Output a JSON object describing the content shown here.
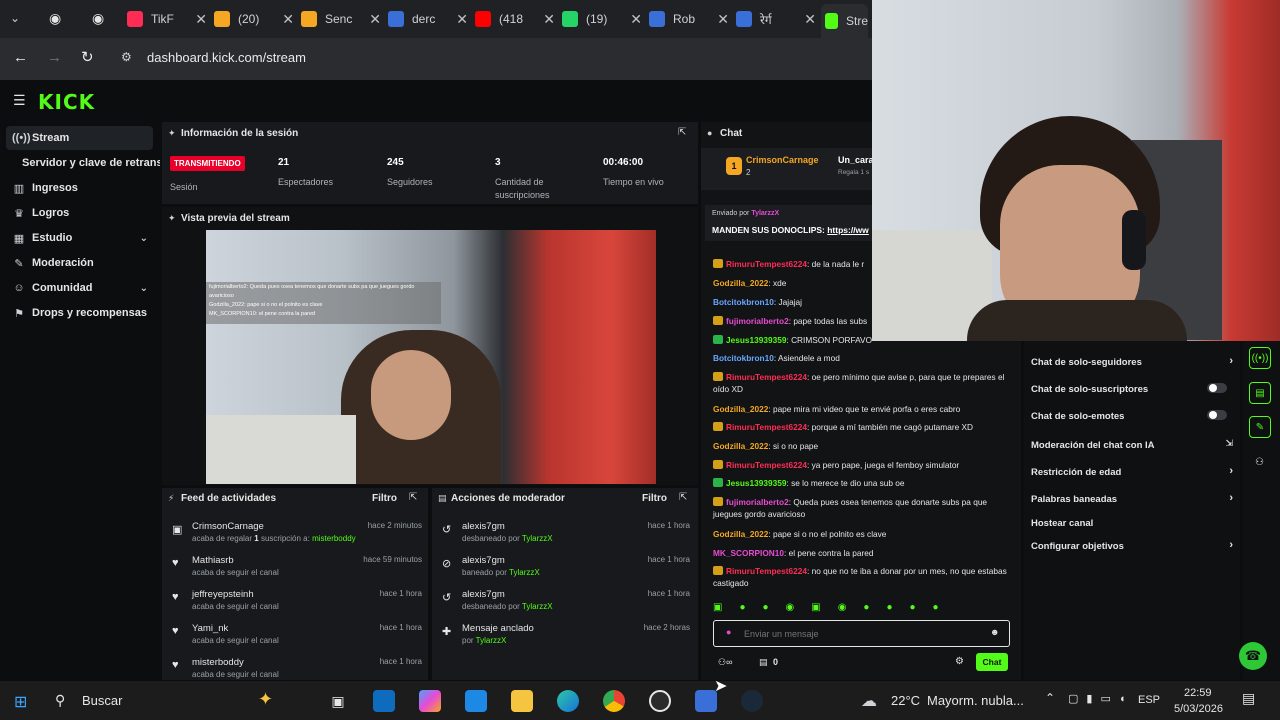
{
  "browser": {
    "tabs": [
      {
        "label": "TikF",
        "color": "#ff2d55"
      },
      {
        "label": "(20)",
        "color": "#f5a623"
      },
      {
        "label": "Senc",
        "color": "#f5a623"
      },
      {
        "label": "derc",
        "color": "#3b6fd8"
      },
      {
        "label": "(418",
        "color": "#ff0000"
      },
      {
        "label": "(19)",
        "color": "#25d366"
      },
      {
        "label": "Rob",
        "color": "#3b6fd8"
      },
      {
        "label": "रेर्ग",
        "color": "#3b6fd8"
      },
      {
        "label": "Stre",
        "color": "#53fc18"
      }
    ],
    "url": "dashboard.kick.com/stream"
  },
  "logo": "KICK",
  "sidebar": {
    "items": [
      {
        "label": "Stream",
        "icon": "broadcast-icon"
      },
      {
        "label": "Servidor y clave de retransm"
      },
      {
        "label": "Ingresos",
        "icon": "chart-icon"
      },
      {
        "label": "Logros",
        "icon": "trophy-icon"
      },
      {
        "label": "Estudio",
        "icon": "studio-icon"
      },
      {
        "label": "Moderación",
        "icon": "wrench-icon"
      },
      {
        "label": "Comunidad",
        "icon": "users-icon"
      },
      {
        "label": "Drops y recompensas",
        "icon": "gift-icon"
      }
    ]
  },
  "session": {
    "title": "Información de la sesión",
    "status": "TRANSMITIENDO",
    "status_label": "Sesión",
    "stats": [
      {
        "value": "21",
        "label": "Espectadores"
      },
      {
        "value": "245",
        "label": "Seguidores"
      },
      {
        "value": "3",
        "label": "Cantidad de suscripciones"
      },
      {
        "value": "00:46:00",
        "label": "Tiempo en vivo"
      }
    ]
  },
  "preview": {
    "title": "Vista previa del stream",
    "overlay_lines": [
      "fujimorialberto2: Queda pues osea tenemos que donarte subs pa que juegues gordo avaricioso",
      "Godzilla_2022: pape si o no el polnito es clave",
      "MK_SCORPION10: el pene contra la pared"
    ]
  },
  "feed": {
    "title": "Feed de actividades",
    "filter": "Filtro",
    "items": [
      {
        "name": "CrimsonCarnage",
        "sub_prefix": "acaba de regalar ",
        "sub_count": "1",
        "sub_mid": " suscripción a: ",
        "sub_target": "misterboddy",
        "time": "hace 2 minutos",
        "icon": "gift-icon"
      },
      {
        "name": "Mathiasrb",
        "sub": "acaba de seguir el canal",
        "time": "hace 59 minutos",
        "icon": "heart-icon"
      },
      {
        "name": "jeffreyepsteinh",
        "sub": "acaba de seguir el canal",
        "time": "hace 1 hora",
        "icon": "heart-icon"
      },
      {
        "name": "Yami_nk",
        "sub": "acaba de seguir el canal",
        "time": "hace 1 hora",
        "icon": "heart-icon"
      },
      {
        "name": "misterboddy",
        "sub": "acaba de seguir el canal",
        "time": "hace 1 hora",
        "icon": "heart-icon"
      }
    ]
  },
  "modactions": {
    "title": "Acciones de moderador",
    "filter": "Filtro",
    "items": [
      {
        "name": "alexis7gm",
        "sub": "desbaneado por ",
        "by": "TylarzzX",
        "time": "hace 1 hora",
        "icon": "undo-icon"
      },
      {
        "name": "alexis7gm",
        "sub": "baneado por ",
        "by": "TylarzzX",
        "time": "hace 1 hora",
        "icon": "ban-icon"
      },
      {
        "name": "alexis7gm",
        "sub": "desbaneado por ",
        "by": "TylarzzX",
        "time": "hace 1 hora",
        "icon": "undo-icon"
      },
      {
        "name": "Mensaje anclado",
        "sub": "por ",
        "by": "TylarzzX",
        "time": "hace 2 horas",
        "icon": "pin-icon"
      }
    ]
  },
  "chat": {
    "title": "Chat",
    "gifter": {
      "name": "CrimsonCarnage",
      "count": "2",
      "target": "Un_cara",
      "note": "Regala 1 s"
    },
    "pinned": {
      "sent_by": "Enviado por",
      "author": "TylarzzX",
      "text": "MANDEN SUS DONOCLIPS: ",
      "link": "https://ww"
    },
    "messages": [
      {
        "user": "RimuruTempest6224",
        "cls": "u-red",
        "badge": "gold",
        "text": ": de la nada le r"
      },
      {
        "user": "Godzilla_2022",
        "cls": "u-orange",
        "badge": "",
        "text": ": xde"
      },
      {
        "user": "Botcitokbron10",
        "cls": "u-blue",
        "badge": "",
        "text": ": Jajajaj"
      },
      {
        "user": "fujimorialberto2",
        "cls": "u-pink",
        "badge": "gold",
        "text": ": pape todas las subs"
      },
      {
        "user": "Jesus13939359",
        "cls": "u-green",
        "badge": "green",
        "text": ": CRIMSON PORFAVOR"
      },
      {
        "user": "Botcitokbron10",
        "cls": "u-blue",
        "badge": "",
        "text": ": Asiendele a mod"
      },
      {
        "user": "RimuruTempest6224",
        "cls": "u-red",
        "badge": "gold",
        "text": ": oe pero mínimo que avise p, para que te prepares el oído XD"
      },
      {
        "user": "Godzilla_2022",
        "cls": "u-orange",
        "badge": "",
        "text": ": pape mira mi video que te envié porfa o eres cabro"
      },
      {
        "user": "RimuruTempest6224",
        "cls": "u-red",
        "badge": "gold",
        "text": ": porque a mí también me cagó putamare XD"
      },
      {
        "user": "Godzilla_2022",
        "cls": "u-orange",
        "badge": "",
        "text": ": si o no pape"
      },
      {
        "user": "RimuruTempest6224",
        "cls": "u-red",
        "badge": "gold",
        "text": ": ya pero pape, juega el femboy simulator"
      },
      {
        "user": "Jesus13939359",
        "cls": "u-green",
        "badge": "green",
        "text": ": se lo merece te dio una sub oe"
      },
      {
        "user": "fujimorialberto2",
        "cls": "u-pink",
        "badge": "gold",
        "text": ": Queda pues osea tenemos que donarte subs pa que juegues gordo avaricioso"
      },
      {
        "user": "Godzilla_2022",
        "cls": "u-orange",
        "badge": "",
        "text": ": pape si o no el polnito es clave"
      },
      {
        "user": "MK_SCORPION10",
        "cls": "u-pink",
        "badge": "",
        "text": ": el pene contra la pared"
      },
      {
        "user": "RimuruTempest6224",
        "cls": "u-red",
        "badge": "gold",
        "text": ": no que no te iba a donar por un mes, no que estabas castigado"
      }
    ],
    "placeholder": "Enviar un mensaje",
    "viewer_count": "0",
    "send_label": "Chat"
  },
  "settings_menu": {
    "items": [
      {
        "label": "Chat de solo-seguidores",
        "kind": "arrow"
      },
      {
        "label": "Chat de solo-suscriptores",
        "kind": "toggle"
      },
      {
        "label": "Chat de solo-emotes",
        "kind": "toggle"
      },
      {
        "label": "Moderación del chat con IA",
        "kind": "external"
      },
      {
        "label": "Restricción de edad",
        "kind": "arrow"
      },
      {
        "label": "Palabras baneadas",
        "kind": "arrow"
      },
      {
        "label": "Hostear canal",
        "kind": "none"
      },
      {
        "label": "Configurar objetivos",
        "kind": "arrow"
      }
    ]
  },
  "taskbar": {
    "search": "Buscar",
    "weather_temp": "22°C",
    "weather_text": "Mayorm. nubla...",
    "lang": "ESP",
    "time": "22:59",
    "date": "5/03/2026"
  },
  "colors": {
    "accent": "#53fc18",
    "live": "#e8002a",
    "panel": "#17191c"
  }
}
